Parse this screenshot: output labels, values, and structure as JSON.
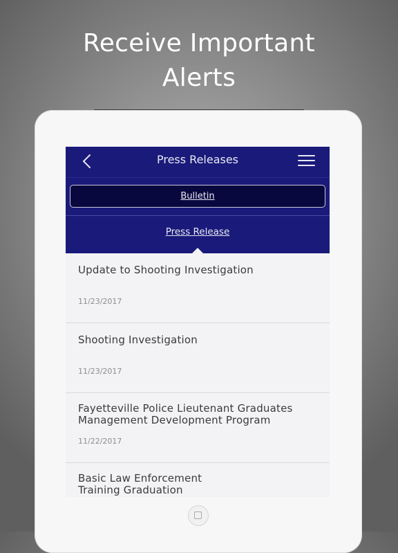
{
  "headline": {
    "line1": "Receive Important",
    "line2": "Alerts"
  },
  "navbar": {
    "title": "Press Releases",
    "back_icon": "chevron-left-icon",
    "menu_icon": "hamburger-menu-icon"
  },
  "tabs": {
    "bulletin": "Bulletin",
    "press_release": "Press Release"
  },
  "items": [
    {
      "title_line1": "Update to Shooting Investigation",
      "title_line2": "",
      "date": "11/23/2017"
    },
    {
      "title_line1": "Shooting Investigation",
      "title_line2": "",
      "date": "11/23/2017"
    },
    {
      "title_line1": "Fayetteville Police Lieutenant Graduates",
      "title_line2": "Management Development Program",
      "date": "11/22/2017"
    },
    {
      "title_line1": "Basic Law Enforcement",
      "title_line2": "Training Graduation",
      "date": ""
    }
  ],
  "colors": {
    "navbar": "#1a1a7a",
    "bulletin_button": "#08083f",
    "list_bg": "#f3f3f5"
  }
}
